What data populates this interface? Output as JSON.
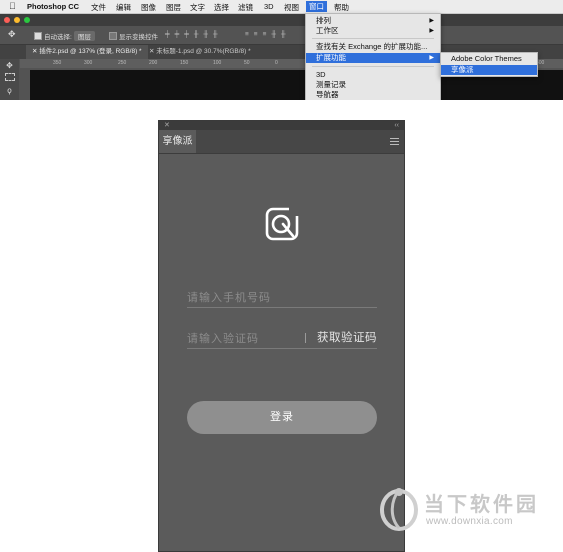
{
  "menubar": {
    "app_name": "Photoshop CC",
    "items": [
      "文件",
      "编辑",
      "图像",
      "图层",
      "文字",
      "选择",
      "滤镜",
      "3D",
      "视图",
      "窗口",
      "帮助"
    ],
    "active_item": "窗口"
  },
  "options_bar": {
    "auto_select_label": "自动选择:",
    "auto_select_value": "图层",
    "show_transform_label": "显示变换控件"
  },
  "doc_tabs": [
    {
      "label": "插件2.psd @ 137% (登录, RGB/8) *"
    },
    {
      "label": "未标题-1.psd @ 30.7%(RGB/8) *"
    }
  ],
  "ruler_ticks": [
    "350",
    "300",
    "250",
    "200",
    "150",
    "100",
    "50",
    "0",
    "50",
    "100",
    "150",
    "200",
    "250",
    "300",
    "350",
    "400",
    "450"
  ],
  "window_menu": {
    "items": [
      {
        "label": "排列",
        "arrow": "▶"
      },
      {
        "label": "工作区",
        "arrow": "▶"
      },
      {
        "label": "查找有关 Exchange 的扩展功能...",
        "arrow": ""
      },
      {
        "label": "扩展功能",
        "arrow": "▶"
      },
      {
        "label": "3D",
        "arrow": ""
      },
      {
        "label": "测量记录",
        "arrow": ""
      },
      {
        "label": "导航器",
        "arrow": ""
      }
    ],
    "highlighted": "扩展功能"
  },
  "extensions_submenu": {
    "items": [
      {
        "label": "Adobe Color Themes"
      },
      {
        "label": "享像派"
      }
    ],
    "highlighted": "享像派"
  },
  "panel": {
    "close_glyph": "✕",
    "collapse_glyph": "‹‹",
    "tab_label": "享像派",
    "menu_icon": "hamburger-icon",
    "logo_icon": "xiangxiangpai-logo-icon",
    "phone_placeholder": "请输入手机号码",
    "code_placeholder": "请输入验证码",
    "get_code_label": "获取验证码",
    "login_label": "登录"
  },
  "watermark": {
    "name": "当下软件园",
    "url": "www.downxia.com"
  },
  "colors": {
    "panel_bg": "#5b5b5b",
    "menu_highlight": "#2f6fdb",
    "login_button": "#8f8f8f"
  }
}
